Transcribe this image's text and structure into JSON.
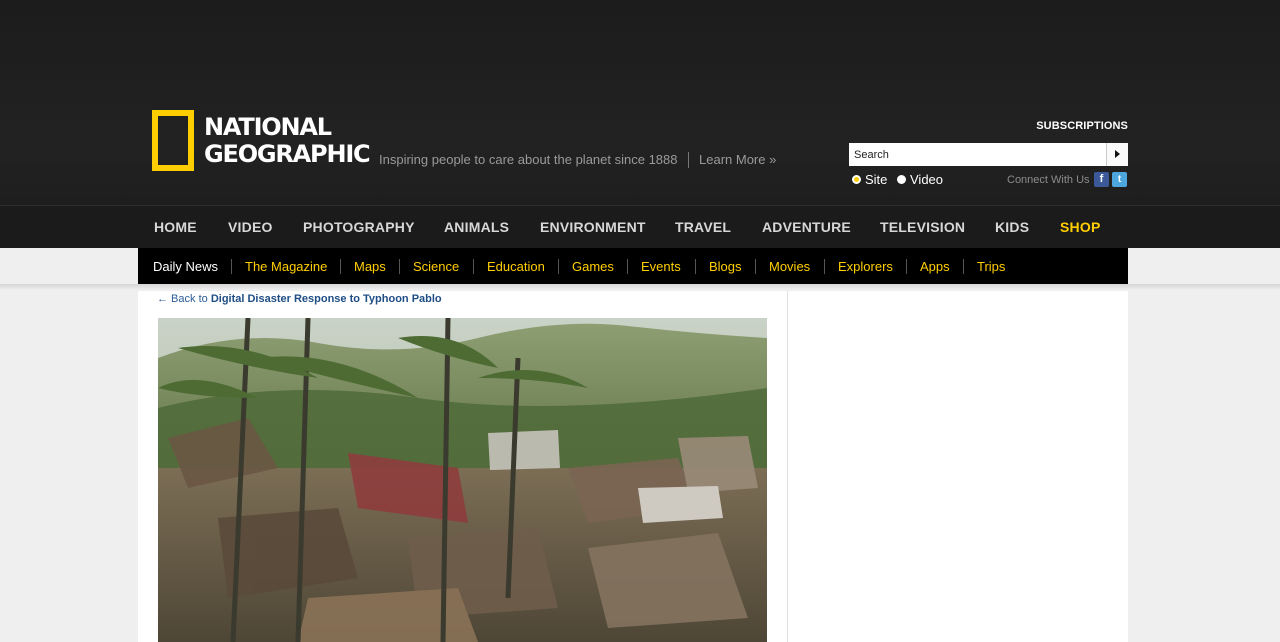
{
  "header": {
    "logo_line1": "NATIONAL",
    "logo_line2": "GEOGRAPHIC",
    "tagline": "Inspiring people to care about the planet since 1888",
    "learn_more": "Learn More »",
    "subscriptions": "SUBSCRIPTIONS",
    "search": {
      "placeholder": "Search",
      "options": [
        "Site",
        "Video"
      ],
      "selected": "Site"
    },
    "connect_label": "Connect With Us",
    "social": [
      "facebook-icon",
      "twitter-icon"
    ]
  },
  "nav_primary": [
    "HOME",
    "VIDEO",
    "PHOTOGRAPHY",
    "ANIMALS",
    "ENVIRONMENT",
    "TRAVEL",
    "ADVENTURE",
    "TELEVISION",
    "KIDS",
    "SHOP"
  ],
  "nav_secondary": [
    "Daily News",
    "The Magazine",
    "Maps",
    "Science",
    "Education",
    "Games",
    "Events",
    "Blogs",
    "Movies",
    "Explorers",
    "Apps",
    "Trips"
  ],
  "nav_secondary_active": "Daily News",
  "content": {
    "back_prefix": "← Back to",
    "back_title": "Digital Disaster Response to Typhoon Pablo",
    "photo_subject": "typhoon-damaged village photo"
  },
  "colors": {
    "accent": "#ffce00",
    "header_bg": "#1e1e1e",
    "link": "#1f4d86"
  }
}
